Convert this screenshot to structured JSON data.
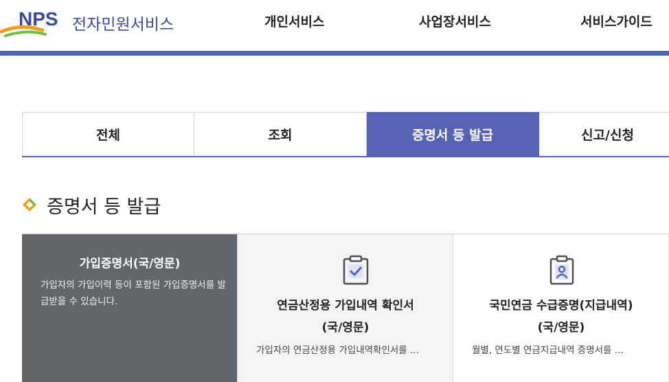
{
  "header": {
    "logo_text": "NPS",
    "service_name": "전자민원서비스",
    "nav": [
      "개인서비스",
      "사업장서비스",
      "서비스가이드"
    ]
  },
  "tabs": [
    {
      "label": "전체",
      "active": false
    },
    {
      "label": "조회",
      "active": false
    },
    {
      "label": "증명서 등 발급",
      "active": true
    },
    {
      "label": "신고/신청",
      "active": false
    }
  ],
  "section": {
    "title": "증명서 등 발급"
  },
  "cards": [
    {
      "title": "가입증명서(국/영문)",
      "description": "가입자의 가입이력 등이 포함된 가입증명서를 발급받을 수 있습니다.",
      "icon": "clipboard-check-icon"
    },
    {
      "title_line1": "연금산정용 가입내역 확인서",
      "title_line2": "(국/영문)",
      "description": "가입자의 연금산정용 가입내역확인서를 ...",
      "icon": "clipboard-check-icon"
    },
    {
      "title_line1": "국민연금 수급증명(지급내역)",
      "title_line2": "(국/영문)",
      "description": "월별, 연도별 연금지급내역 증명서를 ...",
      "icon": "id-badge-icon"
    }
  ],
  "colors": {
    "brand": "#5463b3",
    "accent_orange": "#f39c1f",
    "accent_green": "#6fbd3c",
    "card_dark": "#61666b"
  }
}
